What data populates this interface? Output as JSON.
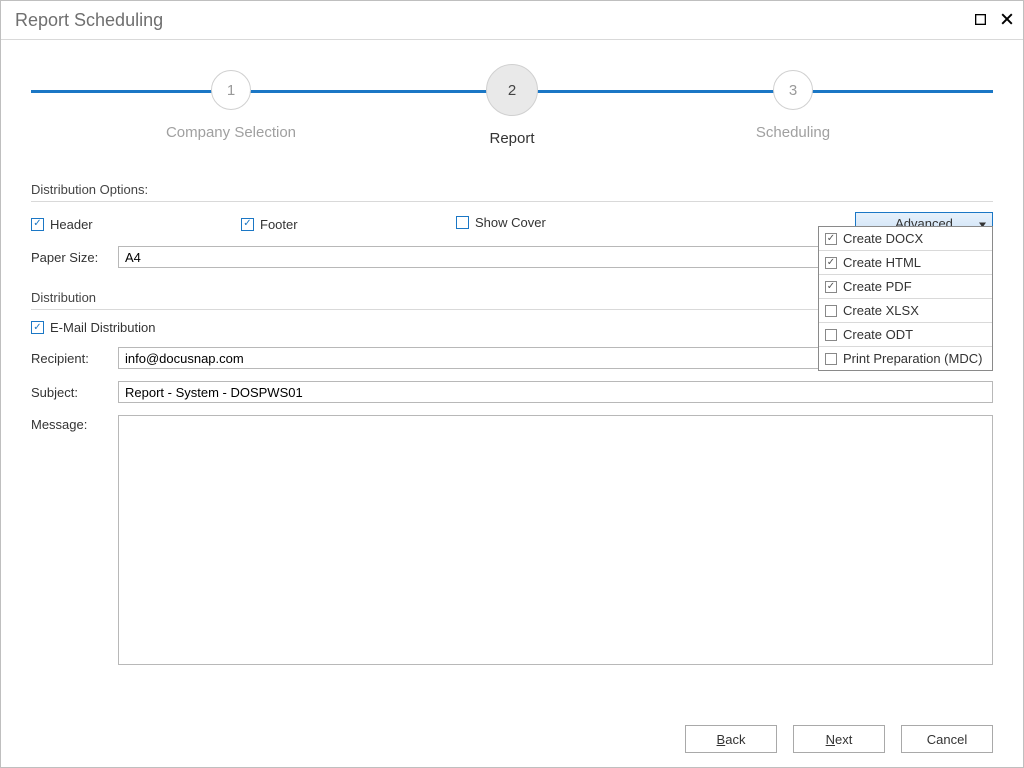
{
  "title": "Report Scheduling",
  "stepper": {
    "steps": [
      {
        "num": "1",
        "label": "Company Selection",
        "active": false
      },
      {
        "num": "2",
        "label": "Report",
        "active": true
      },
      {
        "num": "3",
        "label": "Scheduling",
        "active": false
      }
    ]
  },
  "distribution_options": {
    "heading": "Distribution Options:",
    "header": {
      "label": "Header",
      "checked": true
    },
    "footer": {
      "label": "Footer",
      "checked": true
    },
    "show_cover": {
      "label": "Show Cover",
      "checked": false
    },
    "advanced_label": "Advanced",
    "advanced_menu": [
      {
        "label": "Create DOCX",
        "checked": true
      },
      {
        "label": "Create HTML",
        "checked": true
      },
      {
        "label": "Create PDF",
        "checked": true
      },
      {
        "label": "Create XLSX",
        "checked": false
      },
      {
        "label": "Create ODT",
        "checked": false
      },
      {
        "label": "Print Preparation (MDC)",
        "checked": false
      }
    ],
    "paper_size_label": "Paper Size:",
    "paper_size_value": "A4"
  },
  "distribution": {
    "heading": "Distribution",
    "email_dist": {
      "label": "E-Mail Distribution",
      "checked": true
    },
    "recipient_label": "Recipient:",
    "recipient_value": "info@docusnap.com",
    "subject_label": "Subject:",
    "subject_value": "Report - System - DOSPWS01",
    "message_label": "Message:",
    "message_value": ""
  },
  "buttons": {
    "back": "Back",
    "next": "Next",
    "cancel": "Cancel"
  }
}
